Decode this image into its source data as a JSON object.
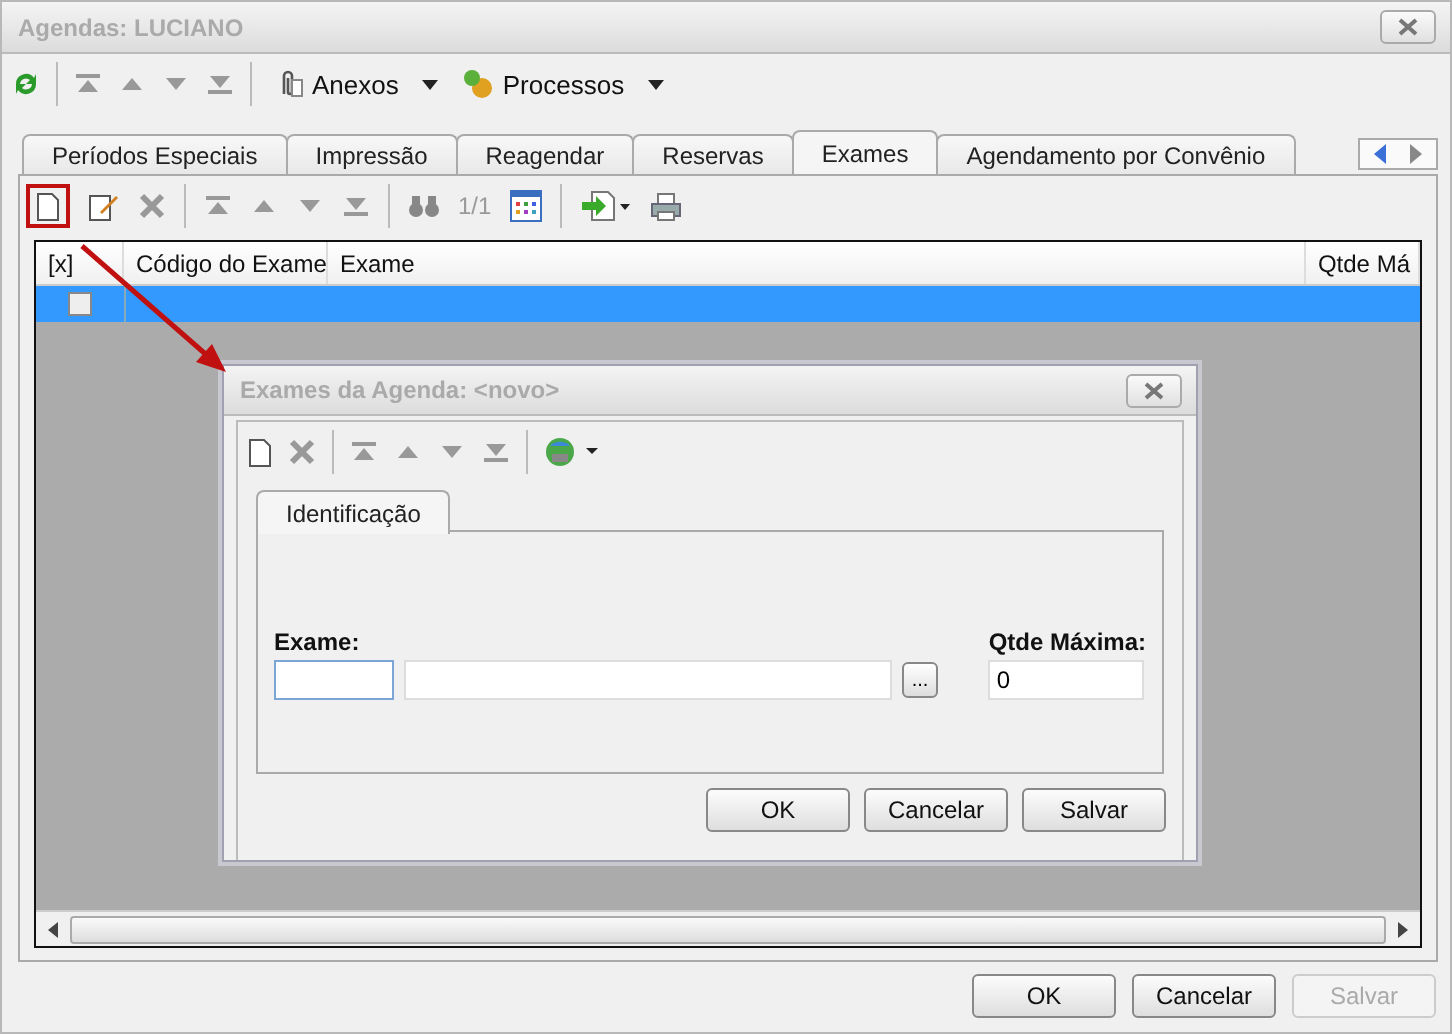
{
  "window": {
    "title": "Agendas: LUCIANO"
  },
  "toolbar": {
    "attachments": "Anexos",
    "processes": "Processos"
  },
  "tabs": [
    {
      "label": "Períodos Especiais",
      "selected": false
    },
    {
      "label": "Impressão",
      "selected": false
    },
    {
      "label": "Reagendar",
      "selected": false
    },
    {
      "label": "Reservas",
      "selected": false
    },
    {
      "label": "Exames",
      "selected": true
    },
    {
      "label": "Agendamento por Convênio",
      "selected": false
    }
  ],
  "sub_toolbar": {
    "record_counter": "1/1",
    "new_button_highlighted": true
  },
  "grid": {
    "columns": [
      "[x]",
      "Código do Exame",
      "Exame",
      "Qtde Má"
    ],
    "rows": [
      {
        "checked": false,
        "selected": true
      }
    ]
  },
  "dialog": {
    "title": "Exames da Agenda: <novo>",
    "tabs": [
      {
        "label": "Identificação",
        "selected": true
      }
    ],
    "exam_label": "Exame:",
    "browse_button": "...",
    "max_qty_label": "Qtde Máxima:",
    "max_qty_value": "0",
    "buttons": [
      {
        "label": "OK",
        "disabled": false
      },
      {
        "label": "Cancelar",
        "disabled": false
      },
      {
        "label": "Salvar",
        "disabled": false
      }
    ]
  },
  "buttons": [
    {
      "label": "OK",
      "disabled": false
    },
    {
      "label": "Cancelar",
      "disabled": false
    },
    {
      "label": "Salvar",
      "disabled": true
    }
  ]
}
